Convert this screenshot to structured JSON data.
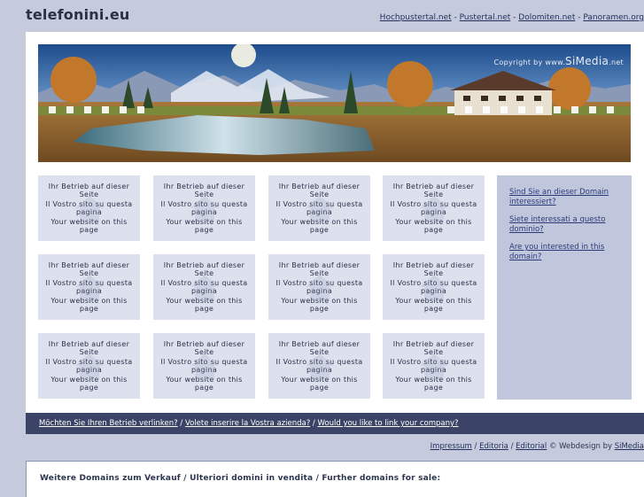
{
  "header": {
    "site_title": "telefonini.eu",
    "links": [
      "Hochpustertal.net",
      "Pustertal.net",
      "Dolomiten.net",
      "Panoramen.org"
    ]
  },
  "banner": {
    "copyright_prefix": "Copyright by www.",
    "copyright_brand": "SiMedia",
    "copyright_suffix": ".net"
  },
  "cells": [
    {
      "de": "Ihr Betrieb auf dieser Seite",
      "it": "Il Vostro sito su questa pagina",
      "en": "Your website on this page"
    },
    {
      "de": "Ihr Betrieb auf dieser Seite",
      "it": "Il Vostro sito su questa pagina",
      "en": "Your website on this page"
    },
    {
      "de": "Ihr Betrieb auf dieser Seite",
      "it": "Il Vostro sito su questa pagina",
      "en": "Your website on this page"
    },
    {
      "de": "Ihr Betrieb auf dieser Seite",
      "it": "Il Vostro sito su questa pagina",
      "en": "Your website on this page"
    },
    {
      "de": "Ihr Betrieb auf dieser Seite",
      "it": "Il Vostro sito su questa pagina",
      "en": "Your website on this page"
    },
    {
      "de": "Ihr Betrieb auf dieser Seite",
      "it": "Il Vostro sito su questa pagina",
      "en": "Your website on this page"
    },
    {
      "de": "Ihr Betrieb auf dieser Seite",
      "it": "Il Vostro sito su questa pagina",
      "en": "Your website on this page"
    },
    {
      "de": "Ihr Betrieb auf dieser Seite",
      "it": "Il Vostro sito su questa pagina",
      "en": "Your website on this page"
    },
    {
      "de": "Ihr Betrieb auf dieser Seite",
      "it": "Il Vostro sito su questa pagina",
      "en": "Your website on this page"
    },
    {
      "de": "Ihr Betrieb auf dieser Seite",
      "it": "Il Vostro sito su questa pagina",
      "en": "Your website on this page"
    },
    {
      "de": "Ihr Betrieb auf dieser Seite",
      "it": "Il Vostro sito su questa pagina",
      "en": "Your website on this page"
    },
    {
      "de": "Ihr Betrieb auf dieser Seite",
      "it": "Il Vostro sito su questa pagina",
      "en": "Your website on this page"
    }
  ],
  "sidebar": {
    "links": [
      "Sind Sie an dieser Domain interessiert?",
      "Siete interessati a questo dominio?",
      "Are you interested in this domain?"
    ]
  },
  "bottom_bar": {
    "links": [
      "Möchten Sie Ihren Betrieb verlinken?",
      "Volete inserire la Vostra azienda?",
      "Would you like to link your company?"
    ]
  },
  "footer": {
    "links": [
      "Impressum",
      "Editoria",
      "Editorial"
    ],
    "credit_prefix": "© Webdesign by",
    "credit_link": "SiMedia"
  },
  "domains": {
    "heading": "Weitere Domains zum Verkauf / Ulteriori domini in vendita / Further domains for sale:"
  },
  "colors": {
    "page_bg": "#c5cbdc",
    "cell_bg": "#dde1ee",
    "sidebar_bg": "#c0c6dc",
    "bar_bg": "#3b4466"
  }
}
